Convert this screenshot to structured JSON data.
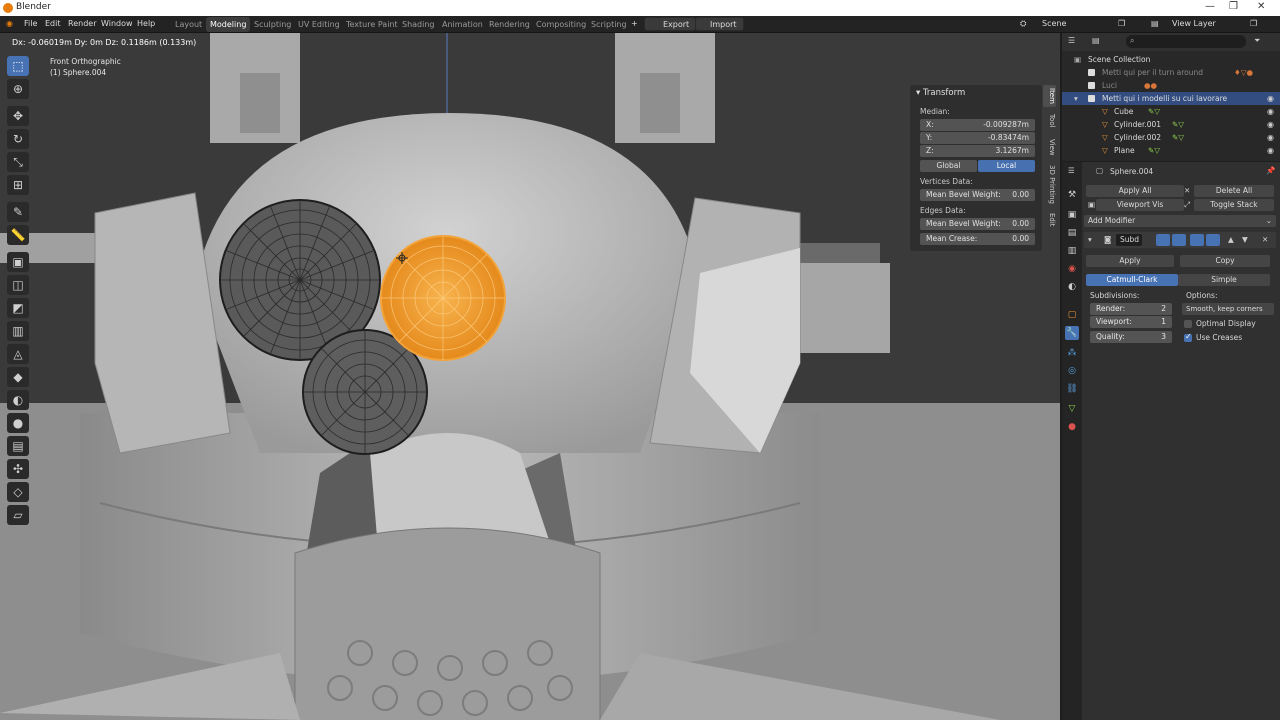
{
  "app": {
    "title": "Blender"
  },
  "window_controls": {
    "minimize": "—",
    "maximize": "❐",
    "close": "✕"
  },
  "menu": [
    "File",
    "Edit",
    "Render",
    "Window",
    "Help"
  ],
  "workspaces": [
    {
      "label": "Layout",
      "active": false
    },
    {
      "label": "Modeling",
      "active": true
    },
    {
      "label": "Sculpting",
      "active": false
    },
    {
      "label": "UV Editing",
      "active": false
    },
    {
      "label": "Texture Paint",
      "active": false
    },
    {
      "label": "Shading",
      "active": false
    },
    {
      "label": "Animation",
      "active": false
    },
    {
      "label": "Rendering",
      "active": false
    },
    {
      "label": "Compositing",
      "active": false
    },
    {
      "label": "Scripting",
      "active": false
    }
  ],
  "add_workspace": "+",
  "header_buttons": {
    "export": "Export",
    "import": "Import"
  },
  "scene": {
    "label": "Scene",
    "view_layer": "View Layer"
  },
  "viewport": {
    "transform_info": "Dx: -0.06019m  Dy: 0m  Dz: 0.1186m (0.133m)",
    "view_name": "Front Orthographic",
    "object_name": "(1) Sphere.004"
  },
  "transform_panel": {
    "title": "Transform",
    "median_label": "Median:",
    "fields": [
      {
        "label": "X:",
        "value": "-0.009287m"
      },
      {
        "label": "Y:",
        "value": "-0.83474m"
      },
      {
        "label": "Z:",
        "value": "3.1267m"
      }
    ],
    "global": "Global",
    "local": "Local",
    "vertices_data": "Vertices Data:",
    "vertex_bevel": {
      "label": "Mean Bevel Weight:",
      "value": "0.00"
    },
    "edges_data": "Edges Data:",
    "edge_bevel": {
      "label": "Mean Bevel Weight:",
      "value": "0.00"
    },
    "edge_crease": {
      "label": "Mean Crease:",
      "value": "0.00"
    }
  },
  "sidebar_tabs": [
    "Item",
    "Tool",
    "View",
    "3D Printing",
    "Edit"
  ],
  "outliner": {
    "root": "Scene Collection",
    "rows": [
      {
        "label": "Metti qui per il turn around",
        "indent": 1,
        "selected": false,
        "dim": true
      },
      {
        "label": "Luci",
        "indent": 1,
        "selected": false,
        "dim": true
      },
      {
        "label": "Metti qui i modelli su cui lavorare",
        "indent": 1,
        "selected": true,
        "dim": false
      },
      {
        "label": "Cube",
        "indent": 2,
        "selected": false,
        "dim": false
      },
      {
        "label": "Cylinder.001",
        "indent": 2,
        "selected": false,
        "dim": false
      },
      {
        "label": "Cylinder.002",
        "indent": 2,
        "selected": false,
        "dim": false
      },
      {
        "label": "Plane",
        "indent": 2,
        "selected": false,
        "dim": false
      }
    ]
  },
  "properties": {
    "object_name": "Sphere.004",
    "apply_all": "Apply All",
    "delete_all": "Delete All",
    "viewport_vis": "Viewport Vis",
    "toggle_stack": "Toggle Stack",
    "add_modifier": "Add Modifier",
    "modifier_name": "Subd",
    "apply": "Apply",
    "copy": "Copy",
    "catmull": "Catmull-Clark",
    "simple": "Simple",
    "subdivisions": "Subdivisions:",
    "options": "Options:",
    "render": {
      "label": "Render:",
      "value": "2"
    },
    "viewport_level": {
      "label": "Viewport:",
      "value": "1"
    },
    "quality": {
      "label": "Quality:",
      "value": "3"
    },
    "uv_smooth": "Smooth, keep corners",
    "optimal_display": "Optimal Display",
    "optimal_display_on": false,
    "use_creases": "Use Creases",
    "use_creases_on": true
  },
  "colors": {
    "accent": "#4772b3",
    "selection_orange": "#f29a2e",
    "mesh_gray": "#b4b4b4"
  }
}
